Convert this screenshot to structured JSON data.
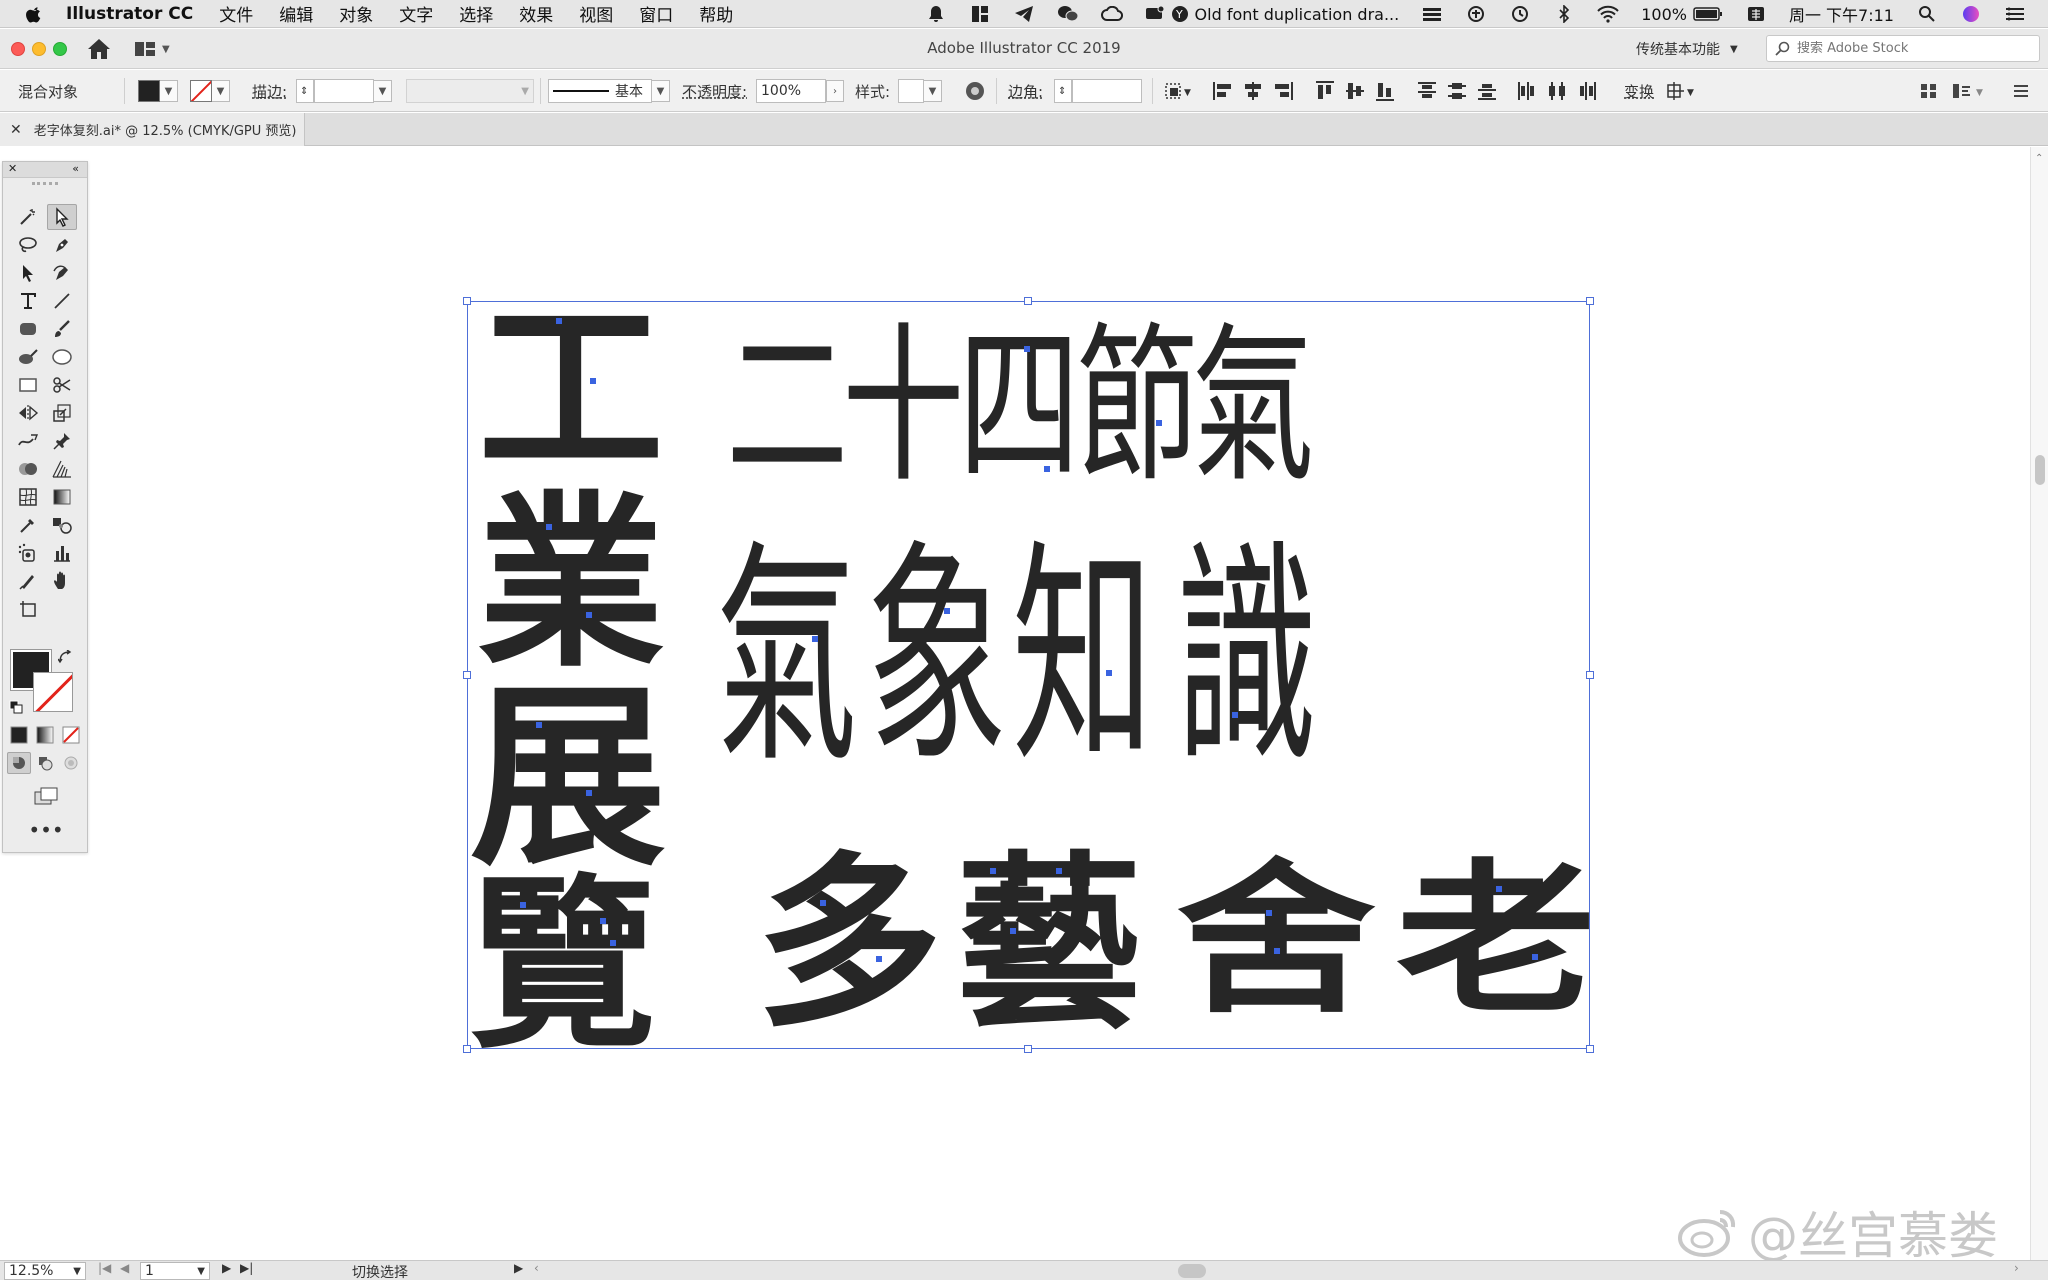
{
  "menubar": {
    "app_name": "Illustrator CC",
    "items": [
      "文件",
      "编辑",
      "对象",
      "文字",
      "选择",
      "效果",
      "视图",
      "窗口",
      "帮助"
    ],
    "now_playing": "Old font duplication dra...",
    "battery": "100%",
    "clock": "周一 下午7:11"
  },
  "titlebar": {
    "window_title": "Adobe Illustrator CC 2019",
    "workspace": "传统基本功能",
    "stock_placeholder": "搜索 Adobe Stock"
  },
  "controlbar": {
    "selection_type": "混合对象",
    "stroke_label": "描边:",
    "stroke_style": "基本",
    "opacity_label": "不透明度:",
    "opacity_value": "100%",
    "style_label": "样式:",
    "corner_label": "边角:",
    "transform_label": "变换"
  },
  "document_tab": {
    "title": "老字体复刻.ai* @ 12.5% (CMYK/GPU 预览)"
  },
  "artwork": {
    "column_left": [
      "工",
      "業",
      "展",
      "覽"
    ],
    "row_1": [
      "二",
      "十",
      "四",
      "節",
      "氣"
    ],
    "row_2": [
      "氣",
      "象",
      "知",
      "識"
    ],
    "row_3": [
      "多",
      "藝",
      "舍",
      "老"
    ]
  },
  "statusbar": {
    "zoom": "12.5%",
    "artboard": "1",
    "status": "切换选择"
  },
  "watermark": "@丝宫慕娄",
  "colors": {
    "selection_blue": "#4e6fd8",
    "glyph_fill": "#262626",
    "menubar_bg": "#e6e6e6"
  }
}
